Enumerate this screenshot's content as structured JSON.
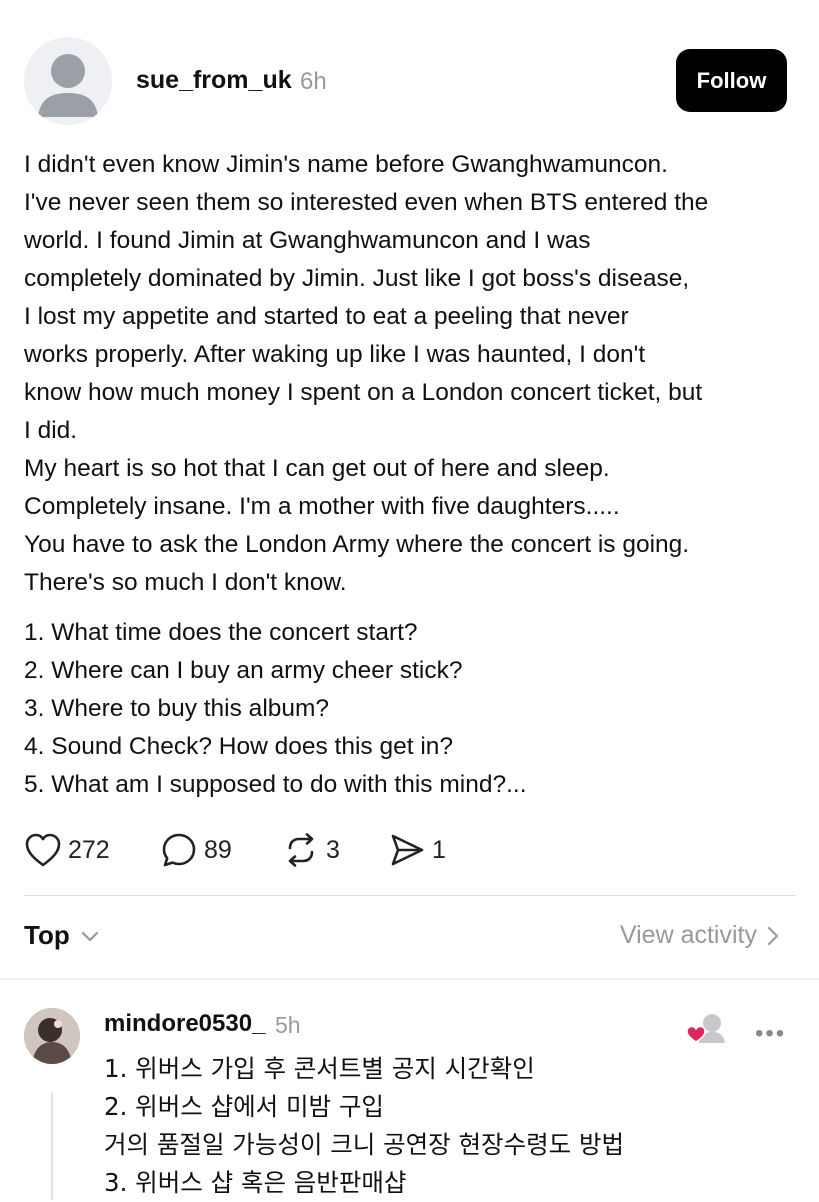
{
  "post": {
    "username": "sue_from_uk",
    "time": "6h",
    "follow_label": "Follow",
    "paragraph_lines": [
      "I didn't even know Jimin's name before Gwanghwamuncon.",
      "I've never seen them so interested even when BTS entered the",
      "world. I found Jimin at Gwanghwamuncon and I was",
      "completely dominated by Jimin. Just like I got boss's disease,",
      "I lost my appetite and started to eat a peeling that never",
      "works properly. After waking up like I was haunted, I don't",
      "know how much money I spent on a London concert ticket, but",
      "I did.",
      "My heart is so hot that I can get out of here and sleep.",
      "Completely insane. I'm a mother with five daughters.....",
      "You have to ask the London Army where the concert is going.",
      "There's so much I don't know."
    ],
    "list_items": [
      "1. What time does the concert start?",
      "2. Where can I buy an army cheer stick?",
      "3. Where to buy this album?",
      "4. Sound Check? How does this get in?",
      "5. What am I supposed to do with this mind?..."
    ],
    "actions": {
      "likes": "272",
      "comments": "89",
      "reposts": "3",
      "shares": "1"
    },
    "icons": {
      "like": "heart-icon",
      "comment": "comment-bubble-icon",
      "repost": "repost-arrows-icon",
      "share": "send-icon"
    }
  },
  "replies_header": {
    "sort_label": "Top",
    "view_activity_label": "View activity"
  },
  "reply": {
    "username": "mindore0530_",
    "time": "5h",
    "more_label": "•••",
    "lines": [
      "1. 위버스 가입 후 콘서트별 공지 시간확인",
      "2. 위버스 샵에서 미밤 구입",
      "거의 품절일 가능성이 크니 공연장 현장수령도 방법",
      "3. 위버스 샵 혹은 음반판매샵"
    ]
  },
  "colors": {
    "follow_bg": "#000000",
    "muted_text": "#9a9a9a",
    "like_heart": "#e0245e"
  }
}
